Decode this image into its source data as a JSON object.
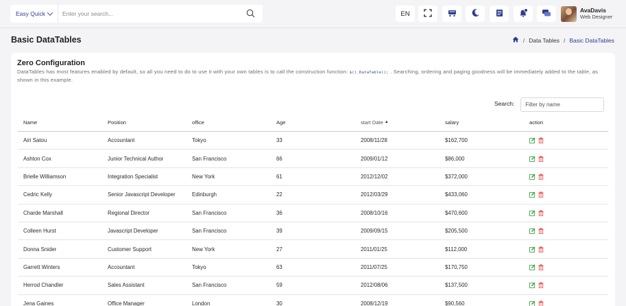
{
  "header": {
    "quick_label": "Easy Quick",
    "search_placeholder": "Enter your search...",
    "language": "EN",
    "user": {
      "name": "AvaDavis",
      "role": "Web Designer"
    }
  },
  "page": {
    "title": "Basic DataTables",
    "breadcrumb": [
      "Data Tables",
      "Basic DataTables"
    ]
  },
  "card": {
    "title": "Zero Configuration",
    "desc_before": "DataTables has most features enabled by default, so all you need to do to use it with your own tables is to call the construction function: ",
    "desc_code": "$().DataTable();",
    "desc_after": " . Searching, ordering and paging goodness will be immediately added to the table, as shown in this example."
  },
  "filter": {
    "label": "Search:",
    "placeholder": "Filter by name"
  },
  "table": {
    "columns": [
      "Name",
      "Position",
      "office",
      "Age",
      "start Date",
      "salary",
      "action"
    ],
    "sort_indicator": "▲",
    "rows": [
      [
        "Airi Satou",
        "Accountant",
        "Tokyo",
        "33",
        "2008/11/28",
        "$162,700"
      ],
      [
        "Ashton Cox",
        "Junior Technical Author",
        "San Francisco",
        "66",
        "2009/01/12",
        "$86,000"
      ],
      [
        "Brielle Williamson",
        "Integration Specialist",
        "New York",
        "61",
        "2012/12/02",
        "$372,000"
      ],
      [
        "Cedric Kelly",
        "Senior Javascript Developer",
        "Edinburgh",
        "22",
        "2012/03/29",
        "$433,060"
      ],
      [
        "Charde Marshall",
        "Regional Director",
        "San Francisco",
        "36",
        "2008/10/16",
        "$470,600"
      ],
      [
        "Colleen Hurst",
        "Javascript Developer",
        "San Francisco",
        "39",
        "2009/09/15",
        "$205,500"
      ],
      [
        "Donna Snider",
        "Customer Support",
        "New York",
        "27",
        "2011/01/25",
        "$112,000"
      ],
      [
        "Garrett Winters",
        "Accountant",
        "Tokyo",
        "63",
        "2011/07/25",
        "$170,750"
      ],
      [
        "Herrod Chandler",
        "Sales Assistant",
        "San Francisco",
        "59",
        "2012/08/06",
        "$137,500"
      ],
      [
        "Jena Gaines",
        "Office Manager",
        "London",
        "30",
        "2008/12/19",
        "$90,560"
      ]
    ]
  },
  "colors": {
    "accent": "#2e3d8c",
    "edit": "#3ea845",
    "delete": "#e5534b"
  },
  "icons": {
    "header": [
      "fullscreen-icon",
      "cart-icon",
      "moon-icon",
      "bookmark-icon",
      "notification-icon",
      "chat-icon"
    ],
    "actions": [
      "edit-icon",
      "trash-icon"
    ]
  }
}
